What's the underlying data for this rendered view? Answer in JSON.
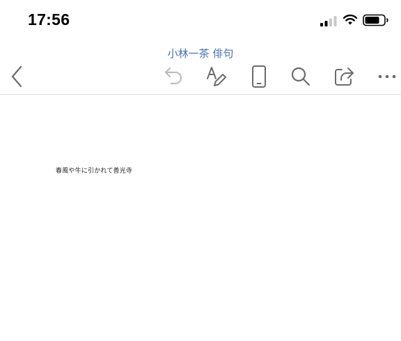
{
  "status_bar": {
    "time": "17:56",
    "icons": [
      "signal-icon",
      "wifi-icon",
      "battery-icon"
    ]
  },
  "document": {
    "title": "小林一茶 俳句",
    "body_text": "春風や牛に引かれて善光寺"
  },
  "toolbar": {
    "items": [
      "back-icon",
      "undo-icon",
      "draw-icon",
      "phone-view-icon",
      "search-icon",
      "share-icon",
      "more-icon"
    ],
    "accent_color": "#4a72b0",
    "icon_color": "#6b6b6b"
  }
}
